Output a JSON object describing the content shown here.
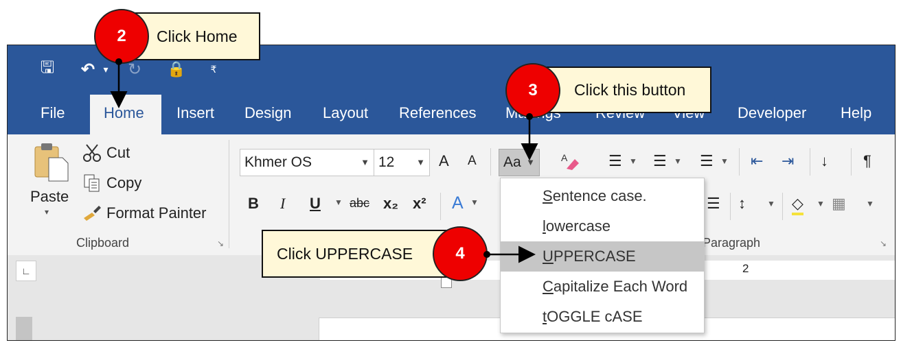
{
  "qat": {
    "save": "🖫",
    "undo": "↶",
    "undo_arrow": "▾",
    "redo": "↻",
    "lock": "🔒",
    "customize": "₹"
  },
  "tabs": [
    "File",
    "Home",
    "Insert",
    "Design",
    "Layout",
    "References",
    "Mailings",
    "Review",
    "View",
    "Developer",
    "Help"
  ],
  "clipboard": {
    "paste": "Paste",
    "paste_arrow": "▾",
    "cut": "Cut",
    "copy": "Copy",
    "format_painter": "Format Painter",
    "group_label": "Clipboard"
  },
  "font": {
    "name": "Khmer OS",
    "size": "12",
    "grow": "A",
    "shrink": "A",
    "change_case": "Aa",
    "bold": "B",
    "italic": "I",
    "underline": "U",
    "strike": "abc",
    "subscript": "x₂",
    "superscript": "x²"
  },
  "paragraph": {
    "group_label": "Paragraph"
  },
  "ruler": {
    "tick": "2"
  },
  "change_case_menu": [
    "Sentence case.",
    "lowercase",
    "UPPERCASE",
    "Capitalize Each Word",
    "tOGGLE cASE"
  ],
  "callouts": {
    "step2": {
      "number": "2",
      "text": "Click Home"
    },
    "step3": {
      "number": "3",
      "text": "Click this button"
    },
    "step4": {
      "number": "4",
      "text": "Click UPPERCASE"
    }
  },
  "colors": {
    "titlebar": "#2b579a",
    "ribbon": "#f3f3f3",
    "badge": "#ee0000",
    "callout_bg": "#fff8d8",
    "highlight": "#c6c6c6"
  }
}
